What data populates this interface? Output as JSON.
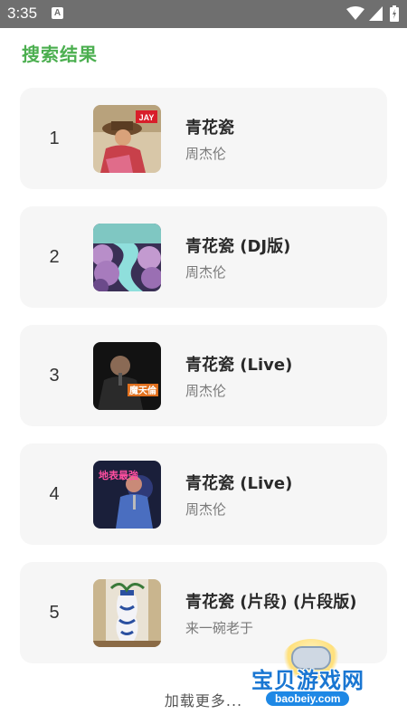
{
  "status_bar": {
    "time": "3:35",
    "notification_badge": "A",
    "icons": [
      "wifi-icon",
      "signal-icon",
      "battery-icon"
    ],
    "background": "#6f6f6f"
  },
  "page": {
    "title": "搜索结果",
    "title_color": "#4caf50",
    "load_more": "加载更多..."
  },
  "results": [
    {
      "rank": "1",
      "title": "青花瓷",
      "artist": "周杰伦"
    },
    {
      "rank": "2",
      "title": "青花瓷 (DJ版)",
      "artist": "周杰伦"
    },
    {
      "rank": "3",
      "title": "青花瓷 (Live)",
      "artist": "周杰伦"
    },
    {
      "rank": "4",
      "title": "青花瓷 (Live)",
      "artist": "周杰伦"
    },
    {
      "rank": "5",
      "title": "青花瓷 (片段) (片段版)",
      "artist": "来一碗老于"
    }
  ],
  "cover_labels": {
    "cover1": "JAY",
    "cover3": "魔天倫",
    "cover4": "地表最強"
  },
  "watermark": {
    "name": "宝贝游戏网",
    "url": "baobeiy.com"
  }
}
